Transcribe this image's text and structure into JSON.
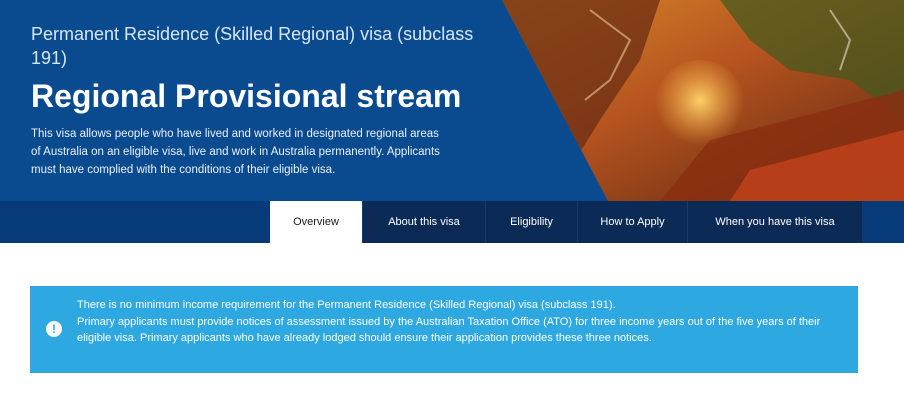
{
  "hero": {
    "subtitle": "Permanent Residence (Skilled Regional) visa (subclass 191)",
    "title": "Regional Provisional stream",
    "description": "This visa allows people who have lived and worked in designated regional areas of Australia on an eligible visa, live and work in Australia permanently. Applicants must have complied with the conditions of their eligible visa."
  },
  "tabs": [
    {
      "label": "Overview",
      "active": true
    },
    {
      "label": "About this visa",
      "active": false
    },
    {
      "label": "Eligibility",
      "active": false
    },
    {
      "label": "How to Apply",
      "active": false
    },
    {
      "label": "When you have this visa",
      "active": false
    }
  ],
  "alert": {
    "icon": "info-icon",
    "line1": "There is no minimum income requirement for the Permanent Residence (Skilled Regional) visa (subclass 191).",
    "line2": "Primary applicants must provide notices of assessment issued by the Australian Taxation Office (ATO) for three income years out of the five years of their eligible visa. Primary applicants who have already lodged should ensure their application provides these three notices."
  },
  "colors": {
    "hero_blue": "#0a4a8f",
    "tab_navy": "#0b2a55",
    "alert_blue": "#2ea8e0"
  }
}
